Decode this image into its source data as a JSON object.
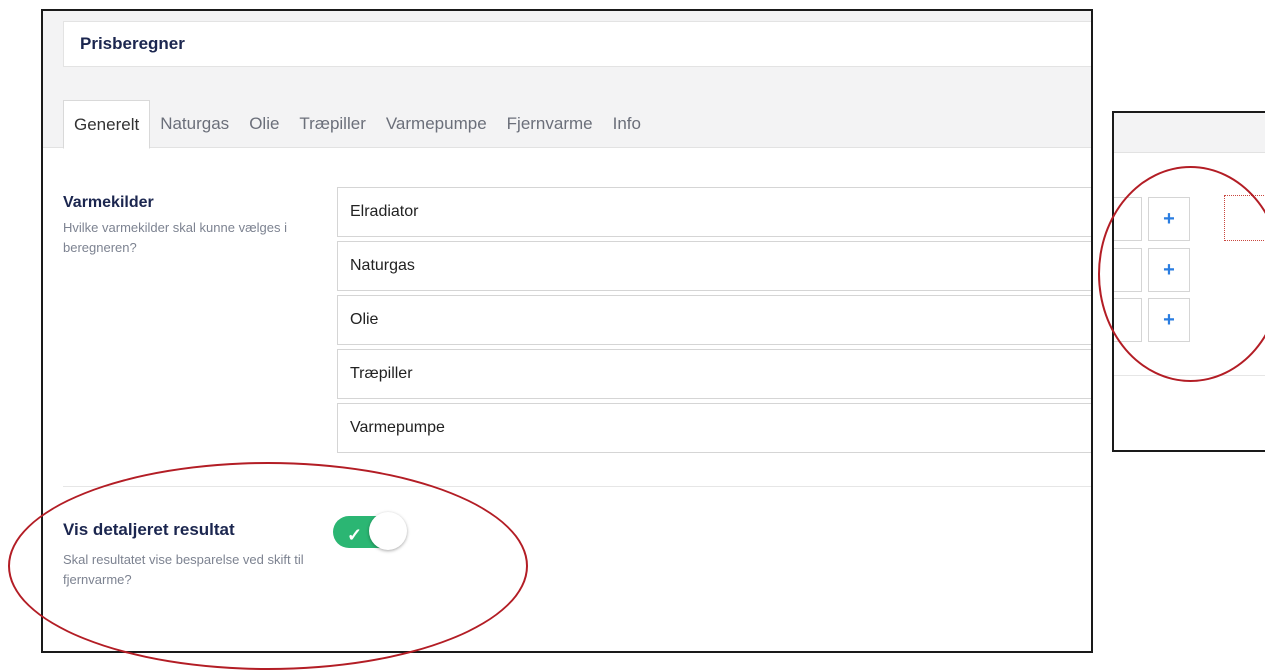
{
  "editor": {
    "title": "Prisberegner",
    "tabs": [
      {
        "label": "Generelt",
        "active": true
      },
      {
        "label": "Naturgas",
        "active": false
      },
      {
        "label": "Olie",
        "active": false
      },
      {
        "label": "Træpiller",
        "active": false
      },
      {
        "label": "Varmepumpe",
        "active": false
      },
      {
        "label": "Fjernvarme",
        "active": false
      },
      {
        "label": "Info",
        "active": false
      }
    ]
  },
  "properties": {
    "heat_sources": {
      "label": "Varmekilder",
      "description": "Hvilke varmekilder skal kunne vælges i beregneren?",
      "items": [
        "Elradiator",
        "Naturgas",
        "Olie",
        "Træpiller",
        "Varmepumpe"
      ]
    },
    "detailed_result": {
      "label": "Vis detaljeret resultat",
      "description": "Skal resultatet vise besparelse ved skift til fjernvarme?",
      "toggle_on": true,
      "toggle_color": "#2bb673",
      "check_glyph": "✓"
    }
  },
  "side_panel": {
    "add_buttons": [
      "+",
      "+",
      "+"
    ],
    "add_icon_color": "#2a7de1"
  },
  "annotation_color": "#b31d25"
}
